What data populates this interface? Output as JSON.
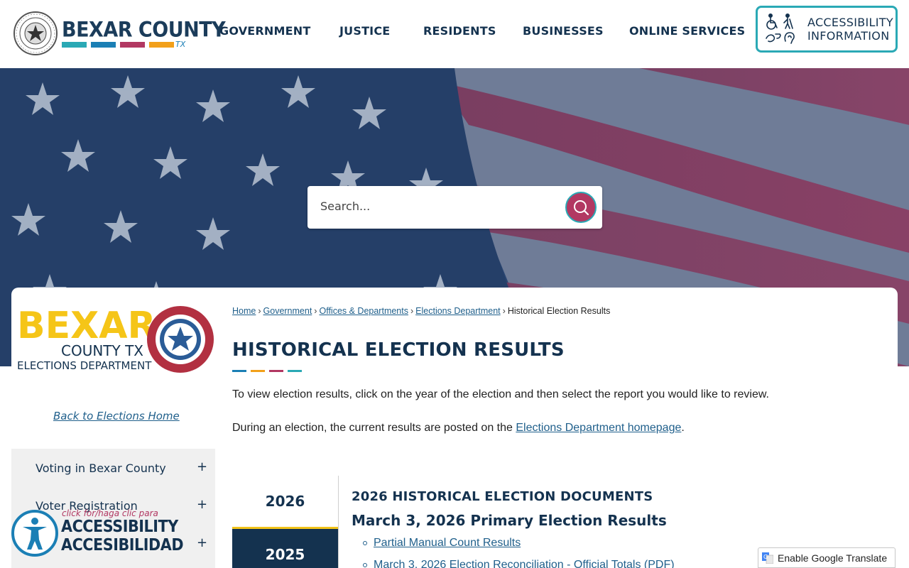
{
  "header": {
    "brand_name": "BEXAR COUNTY",
    "brand_suffix": "TX",
    "brand_colors": [
      "#2aa9b5",
      "#1b7fb5",
      "#b23862",
      "#f2a01a"
    ],
    "nav": [
      {
        "label": "GOVERNMENT"
      },
      {
        "label": "JUSTICE"
      },
      {
        "label": "RESIDENTS"
      },
      {
        "label": "BUSINESSES"
      },
      {
        "label": "ONLINE SERVICES"
      }
    ],
    "accessibility": {
      "line1": "ACCESSIBILITY",
      "line2": "INFORMATION",
      "icon": "accessibility-icons"
    }
  },
  "hero": {
    "search": {
      "placeholder": "Search...",
      "button_icon": "search-icon"
    }
  },
  "sidebar": {
    "logo": {
      "line1": "BEXAR",
      "line2": "COUNTY TX",
      "line3": "ELECTIONS DEPARTMENT"
    },
    "back_link": "Back to Elections Home",
    "items": [
      {
        "label": "Voting in Bexar County",
        "toggle": "+"
      },
      {
        "label": "Voter Registration",
        "toggle": "+"
      },
      {
        "label": "",
        "toggle": "+"
      }
    ]
  },
  "breadcrumb": {
    "items": [
      "Home",
      "Government",
      "Offices & Departments",
      "Elections Department"
    ],
    "current": "Historical Election Results",
    "separator": "›"
  },
  "main": {
    "title": "HISTORICAL ELECTION RESULTS",
    "title_bar_colors": [
      "#1b7fb5",
      "#f2a01a",
      "#b23862",
      "#2aa9b5"
    ],
    "para1": "To view election results, click on the year of the election and then select the report you would like to review.",
    "para2_prefix": "During an election, the current results are posted on the ",
    "para2_link": "Elections Department homepage",
    "para2_suffix": ".",
    "tabs": [
      {
        "label": "2026",
        "active": true
      },
      {
        "label": "2025",
        "active": false
      }
    ],
    "docs_heading": "2026 HISTORICAL ELECTION DOCUMENTS",
    "docs_subheading": "March 3, 2026 Primary Election Results",
    "doc_links": [
      "Partial Manual Count Results",
      "March 3, 2026 Election Reconciliation - Official Totals (PDF)"
    ]
  },
  "accessibility_widget": {
    "click_text": "click for/haga clic para",
    "line1": "ACCESSIBILITY",
    "line2": "ACCESIBILIDAD"
  },
  "google_translate": {
    "label": "Enable Google Translate"
  }
}
